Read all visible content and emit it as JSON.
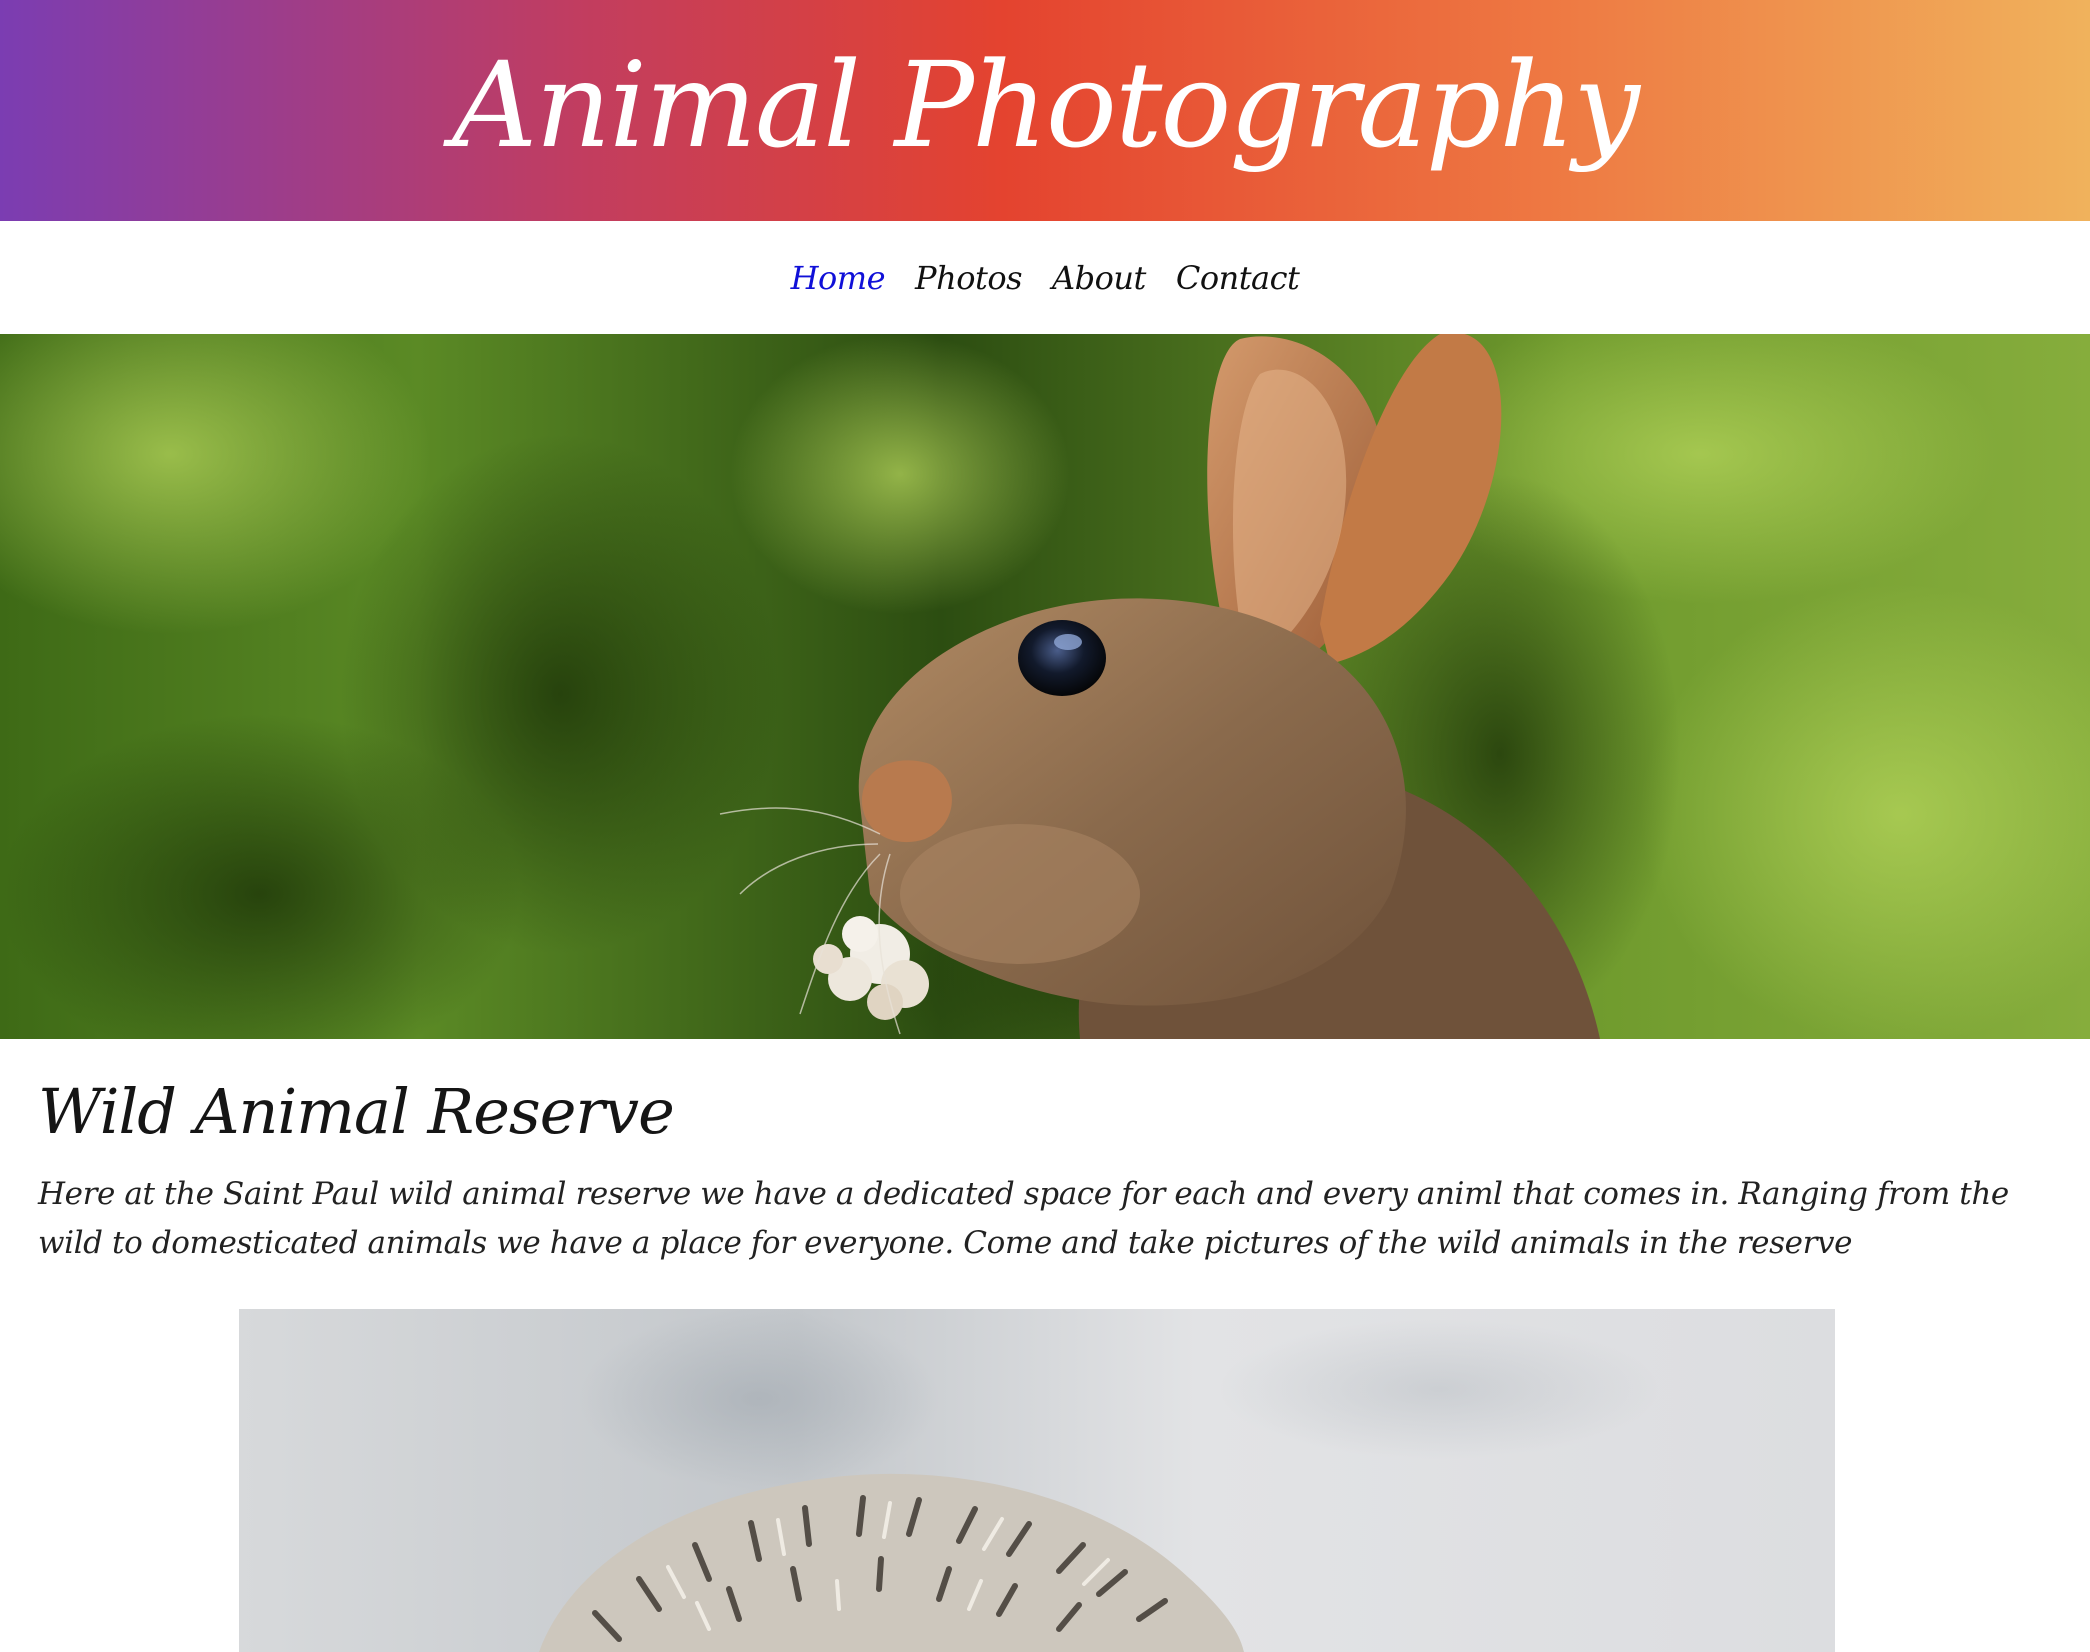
{
  "header": {
    "title": "Animal Photography",
    "gradient_colors": [
      "#7b3db2",
      "#c23d5f",
      "#e4432f",
      "#ee7842",
      "#f0b25c"
    ]
  },
  "nav": {
    "items": [
      {
        "label": "Home",
        "active": true
      },
      {
        "label": "Photos",
        "active": false
      },
      {
        "label": "About",
        "active": false
      },
      {
        "label": "Contact",
        "active": false
      }
    ],
    "active_color": "#1010d8"
  },
  "hero": {
    "subject": "rabbit-with-clover-photo"
  },
  "main": {
    "heading": "Wild Animal Reserve",
    "intro": "Here at the Saint Paul wild animal reserve we have a dedicated space for each and every animl that comes in. Ranging from the wild to domesticated animals we have a place for everyone. Come and take pictures of the wild animals in the reserve"
  },
  "gallery": {
    "subject": "hedgehog-photo"
  }
}
